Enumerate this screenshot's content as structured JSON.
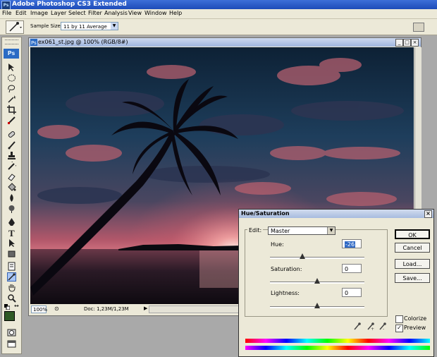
{
  "app": {
    "title": "Adobe Photoshop CS3 Extended",
    "logo": "Ps"
  },
  "menu": [
    "File",
    "Edit",
    "Image",
    "Layer",
    "Select",
    "Filter",
    "Analysis",
    "View",
    "Window",
    "Help"
  ],
  "options": {
    "sample_size_label": "Sample Size:",
    "sample_size_value": "11 by 11 Average"
  },
  "toolbox": {
    "logo": "Ps",
    "tools": [
      "move-tool",
      "marquee-tool",
      "lasso-tool",
      "magic-wand-tool",
      "crop-tool",
      "slice-tool",
      "healing-tool",
      "brush-tool",
      "clone-stamp-tool",
      "history-brush-tool",
      "eraser-tool",
      "gradient-tool",
      "blur-tool",
      "dodge-tool",
      "pen-tool",
      "type-tool",
      "path-selection-tool",
      "shape-tool",
      "notes-tool",
      "eyedropper-tool",
      "hand-tool",
      "zoom-tool"
    ],
    "selected_tool": "eyedropper-tool",
    "foreground_color": "#2f5a25"
  },
  "document": {
    "title": "ex061_st.jpg @ 100% (RGB/8#)",
    "zoom": "100%",
    "doc_info": "Doc: 1,23M/1,23M"
  },
  "dialog": {
    "title": "Hue/Saturation",
    "edit_label": "Edit:",
    "edit_value": "Master",
    "hue": {
      "label": "Hue:",
      "value": "-26"
    },
    "saturation": {
      "label": "Saturation:",
      "value": "0"
    },
    "lightness": {
      "label": "Lightness:",
      "value": "0"
    },
    "buttons": {
      "ok": "OK",
      "cancel": "Cancel",
      "load": "Load...",
      "save": "Save..."
    },
    "colorize": {
      "label": "Colorize",
      "checked": false
    },
    "preview": {
      "label": "Preview",
      "checked": true
    }
  }
}
